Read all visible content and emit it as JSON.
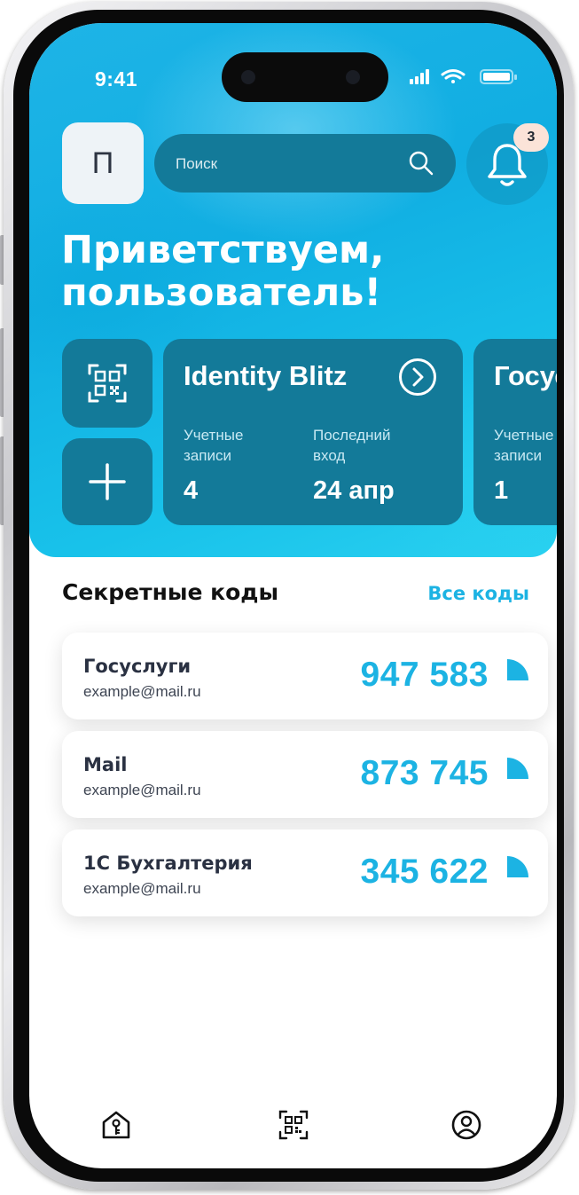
{
  "status_bar": {
    "time": "9:41"
  },
  "header": {
    "avatar_letter": "П",
    "search_placeholder": "Поиск",
    "notifications_count": "3"
  },
  "greeting": {
    "line1": "Приветствуем,",
    "line2": "пользователь!"
  },
  "quick_actions": [
    {
      "icon": "qr-scan-icon"
    },
    {
      "icon": "plus-icon"
    }
  ],
  "services": [
    {
      "title": "Identity Blitz",
      "accounts_label_1": "Учетные",
      "accounts_label_2": "записи",
      "accounts_value": "4",
      "last_login_label_1": "Последний",
      "last_login_label_2": "вход",
      "last_login_value": "24 апр"
    },
    {
      "title": "Госуслуги",
      "accounts_label_1": "Учетные",
      "accounts_label_2": "записи",
      "accounts_value": "1"
    }
  ],
  "codes_section": {
    "title": "Секретные коды",
    "all_link": "Все коды",
    "items": [
      {
        "name": "Госуслуги",
        "email": "example@mail.ru",
        "code": "947 583"
      },
      {
        "name": "Mail",
        "email": "example@mail.ru",
        "code": "873 745"
      },
      {
        "name": "1С Бухгалтерия",
        "email": "example@mail.ru",
        "code": "345 622"
      }
    ]
  },
  "bottom_nav": [
    {
      "icon": "home-key-icon"
    },
    {
      "icon": "qr-scan-icon"
    },
    {
      "icon": "profile-icon"
    }
  ],
  "colors": {
    "accent": "#1cb3e3",
    "card_dark": "#137a99",
    "hero_gradient": "#11aee2",
    "badge_bg": "#fbe3d8"
  }
}
